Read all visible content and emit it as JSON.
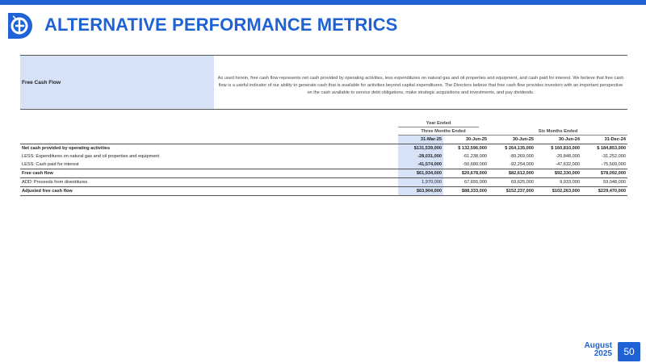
{
  "header": {
    "title": "ALTERNATIVE PERFORMANCE METRICS",
    "brand_color": "#1f62d6",
    "highlight_color": "#d6e3f7"
  },
  "definition": {
    "term": "Free Cash Flow",
    "text": "As used herein, free cash flow represents net cash provided by operating activities, less expenditures on natural gas and oil properties and equipment, and cash paid for interest. We believe that free cash flow is a useful indicator of our ability to generate cash that is available for activities beyond capital expenditures. The Directors believe that free cash flow provides investors with an important perspective on the cash available to service debt obligations, make strategic acquisitions and investments, and pay dividends."
  },
  "table": {
    "year_ended_label": "Year Ended",
    "three_months_label": "Three Months Ended",
    "six_months_label": "Six Months Ended",
    "columns": [
      "31-Mar-25",
      "30-Jun-25",
      "30-Jun-25",
      "30-Jun-24",
      "31-Dec-24"
    ],
    "rows": [
      {
        "label": "Net cash provided by operating activities",
        "values": [
          "$131,539,000",
          "$ 132,596,000",
          "$ 264,135,000",
          "$ 160,810,000",
          "$ 184,853,000"
        ]
      },
      {
        "label": "LESS: Expenditures on natural gas and oil properties and equipment",
        "values": [
          "-28,031,000",
          "-61,238,000",
          "-89,269,000",
          "-20,848,000",
          "-31,252,000"
        ]
      },
      {
        "label": "LESS: Cash paid for interest",
        "values": [
          "-41,574,000",
          "-50,680,000",
          "-92,254,000",
          "-47,632,000",
          "-75,509,000"
        ]
      },
      {
        "label": "Free cash flow",
        "values": [
          "$61,934,000",
          "$20,678,000",
          "$82,612,000",
          "$92,330,000",
          "$78,092,000"
        ]
      },
      {
        "label": "ADD: Proceeds from divestitures",
        "values": [
          "1,970,000",
          "67,655,000",
          "69,625,000",
          "9,933,000",
          "59,048,000"
        ]
      },
      {
        "label": "Adjusted free cash flow",
        "values": [
          "$63,904,000",
          "$88,333,000",
          "$152,237,000",
          "$102,263,000",
          "$229,470,000"
        ]
      }
    ]
  },
  "footer": {
    "month": "August",
    "year": "2025",
    "page": "50"
  }
}
